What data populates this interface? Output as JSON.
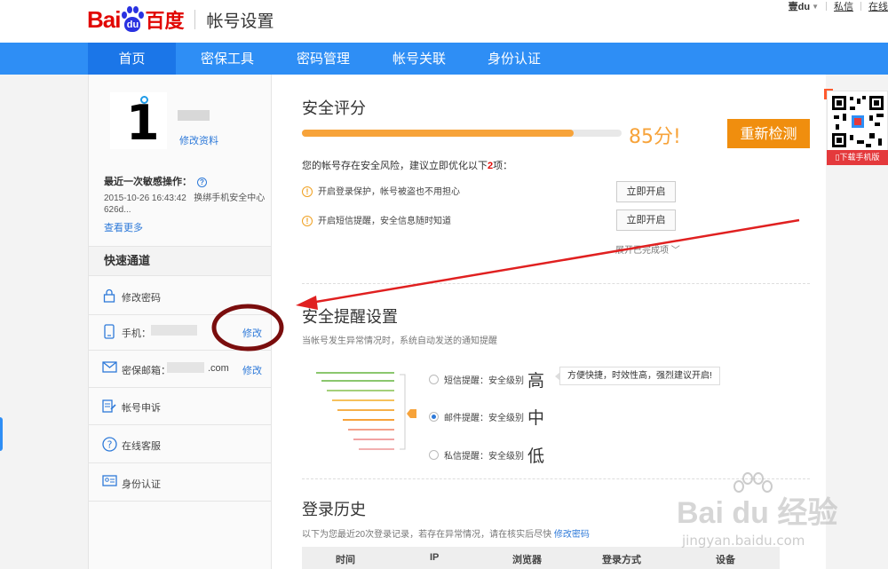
{
  "header": {
    "logo_bai": "Bai",
    "logo_du": "du",
    "logo_cn": "百度",
    "page_title": "帐号设置",
    "username": "壹du",
    "links": [
      "私信",
      "在线"
    ]
  },
  "nav": {
    "items": [
      {
        "label": "首页",
        "active": true
      },
      {
        "label": "密保工具",
        "active": false
      },
      {
        "label": "密码管理",
        "active": false
      },
      {
        "label": "帐号关联",
        "active": false
      },
      {
        "label": "身份认证",
        "active": false
      }
    ]
  },
  "sidebar": {
    "avatar_glyph": "1",
    "edit_profile": "修改资料",
    "recent_title": "最近一次敏感操作：",
    "recent_time": "2015-10-26 16:43:42",
    "recent_desc": "换绑手机安全中心626d...",
    "see_more": "查看更多",
    "quick_title": "快速通道",
    "items": [
      {
        "label": "修改密码",
        "icon": "lock-icon",
        "action": ""
      },
      {
        "label": "手机：",
        "icon": "phone-icon",
        "action": "修改"
      },
      {
        "label": "密保邮箱：",
        "icon": "mail-icon",
        "suffix": ".com",
        "action": "修改"
      },
      {
        "label": "帐号申诉",
        "icon": "appeal-icon",
        "action": ""
      },
      {
        "label": "在线客服",
        "icon": "help-circle-icon",
        "action": ""
      },
      {
        "label": "身份认证",
        "icon": "id-card-icon",
        "action": ""
      }
    ]
  },
  "security": {
    "title": "安全评分",
    "score_text": "85分!",
    "score": 85,
    "recheck_label": "重新检测",
    "risk_prefix": "您的帐号存在安全风险，建议立即优化以下",
    "risk_count": "2",
    "risk_suffix": "项：",
    "items": [
      {
        "text": "开启登录保护，帐号被盗也不用担心",
        "button": "立即开启"
      },
      {
        "text": "开启短信提醒，安全信息随时知道",
        "button": "立即开启"
      }
    ],
    "expand_label": "展开已完成项"
  },
  "reminder": {
    "title": "安全提醒设置",
    "desc": "当帐号发生异常情况时，系统自动发送的通知提醒",
    "options": [
      {
        "label": "短信提醒：安全级别",
        "level": "高",
        "selected": false
      },
      {
        "label": "邮件提醒：安全级别",
        "level": "中",
        "selected": true
      },
      {
        "label": "私信提醒：安全级别",
        "level": "低",
        "selected": false
      }
    ],
    "tip": "方便快捷，时效性高，强烈建议开启!"
  },
  "history": {
    "title": "登录历史",
    "desc": "以下为您最近20次登录记录，若存在异常情况，请在核实后尽快",
    "link": "修改密码",
    "columns": [
      "时间",
      "IP",
      "浏览器",
      "登录方式",
      "设备"
    ]
  },
  "qr": {
    "download_label": "下载手机版"
  },
  "watermark": {
    "brand": "Bai du 经验",
    "url": "jingyan.baidu.com"
  },
  "colors": {
    "nav_blue": "#2e8ef5",
    "nav_active": "#1b76e8",
    "score_orange": "#f7a33a",
    "button_orange": "#f08e0e",
    "link_blue": "#2e7ad9",
    "annotation_red": "#e02020",
    "circle_darkred": "#7a0d0d"
  }
}
